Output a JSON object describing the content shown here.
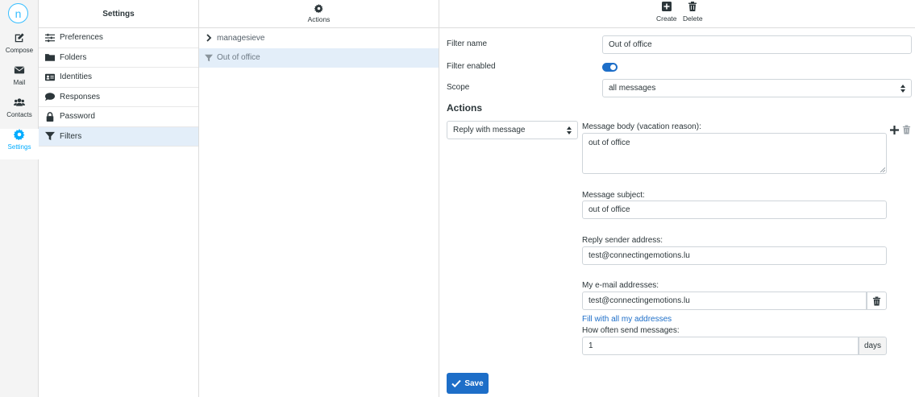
{
  "nav": {
    "items": [
      {
        "label": "Compose",
        "icon": "compose-icon"
      },
      {
        "label": "Mail",
        "icon": "mail-icon"
      },
      {
        "label": "Contacts",
        "icon": "contacts-icon"
      },
      {
        "label": "Settings",
        "icon": "gear-icon"
      }
    ]
  },
  "settings": {
    "title": "Settings",
    "items": [
      {
        "label": "Preferences",
        "icon": "sliders-icon"
      },
      {
        "label": "Folders",
        "icon": "folder-icon"
      },
      {
        "label": "Identities",
        "icon": "id-card-icon"
      },
      {
        "label": "Responses",
        "icon": "comment-icon"
      },
      {
        "label": "Password",
        "icon": "lock-icon"
      },
      {
        "label": "Filters",
        "icon": "filter-icon"
      }
    ]
  },
  "filters": {
    "actions_label": "Actions",
    "set_name": "managesieve",
    "filter_name": "Out of office"
  },
  "toolbar": {
    "create_label": "Create",
    "delete_label": "Delete"
  },
  "form": {
    "filter_name_label": "Filter name",
    "filter_name_value": "Out of office",
    "filter_enabled_label": "Filter enabled",
    "scope_label": "Scope",
    "scope_value": "all messages",
    "actions_heading": "Actions",
    "action_value": "Reply with message",
    "body_label": "Message body (vacation reason):",
    "body_value": "out of office",
    "subject_label": "Message subject:",
    "subject_value": "out of office",
    "sender_label": "Reply sender address:",
    "sender_value": "test@connectingemotions.lu",
    "addresses_label": "My e-mail addresses:",
    "addresses_value": "test@connectingemotions.lu",
    "fill_link": "Fill with all my addresses",
    "often_label": "How often send messages:",
    "often_value": "1",
    "often_unit": "days",
    "save_label": "Save"
  },
  "colors": {
    "accent": "#1d6ec8",
    "active_nav": "#00acff",
    "selected_row": "#e3eef9"
  }
}
